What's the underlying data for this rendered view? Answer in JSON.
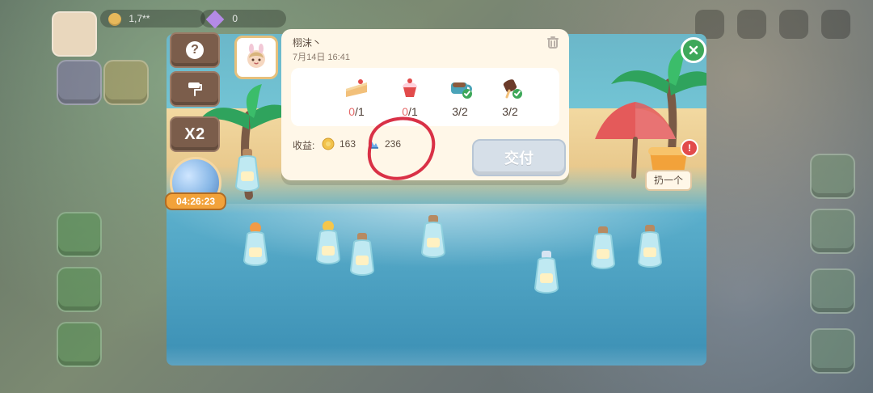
{
  "hud": {
    "coins": "1,7**",
    "gems": "0"
  },
  "left_panel": {
    "help_icon": "question-mark",
    "paint_icon": "paint-roller",
    "speed_label": "X2",
    "timer": "04:26:23"
  },
  "card": {
    "player_name": "栩沫丶",
    "timestamp": "7月14日  16:41",
    "items": [
      {
        "icon": "cake-slice",
        "have": "0",
        "need": "1"
      },
      {
        "icon": "cupcake",
        "have": "0",
        "need": "1"
      },
      {
        "icon": "coffee-cup",
        "have": "3",
        "need": "2"
      },
      {
        "icon": "chocolate-popsicle",
        "have": "3",
        "need": "2"
      }
    ],
    "income_label": "收益:",
    "income_coin": "163",
    "income_xp": "236",
    "deliver_label": "交付"
  },
  "throw_label": "扔一个",
  "alert_label": "!",
  "colors": {
    "annotation_red": "#d7263d",
    "deliver_disabled": "#d6dfe8",
    "close_green": "#3ea85a"
  }
}
